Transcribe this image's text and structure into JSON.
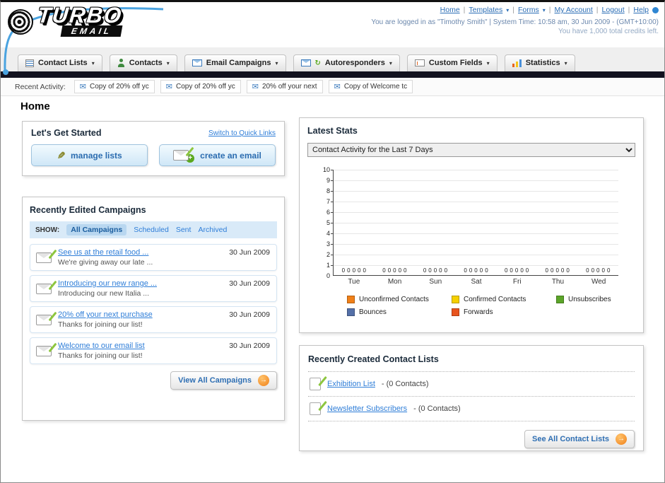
{
  "header": {
    "logo_text": "TURBO",
    "logo_sub": "EMAIL",
    "nav_links": [
      "Home",
      "Templates",
      "Forms",
      "My Account",
      "Logout",
      "Help"
    ],
    "login_info": "You are logged in as \"Timothy Smith\" | System Time: 10:58 am, 30 Jun 2009 - (GMT+10:00)",
    "credits_info": "You have 1,000 total credits left."
  },
  "nav_tabs": [
    {
      "label": "Contact Lists"
    },
    {
      "label": "Contacts"
    },
    {
      "label": "Email Campaigns"
    },
    {
      "label": "Autoresponders"
    },
    {
      "label": "Custom Fields"
    },
    {
      "label": "Statistics"
    }
  ],
  "recent_activity": {
    "label": "Recent Activity:",
    "items": [
      "Copy of 20% off yc",
      "Copy of 20% off yc",
      "20% off your next",
      "Copy of Welcome tc"
    ]
  },
  "page_title": "Home",
  "get_started": {
    "title": "Let's Get Started",
    "switch_link": "Switch to Quick Links",
    "buttons": [
      {
        "label": "manage lists"
      },
      {
        "label": "create an email"
      }
    ]
  },
  "campaigns": {
    "title": "Recently Edited Campaigns",
    "show_label": "SHOW:",
    "filters": [
      "All Campaigns",
      "Scheduled",
      "Sent",
      "Archived"
    ],
    "active_filter": "All Campaigns",
    "items": [
      {
        "title": "See us at the retail food ...",
        "subtitle": "We're giving away our late ...",
        "date": "30 Jun 2009"
      },
      {
        "title": "Introducing our new range ...",
        "subtitle": "Introducing our new Italia ...",
        "date": "30 Jun 2009"
      },
      {
        "title": "20% off your next purchase",
        "subtitle": "Thanks for joining our list!",
        "date": "30 Jun 2009"
      },
      {
        "title": "Welcome to our email list",
        "subtitle": "Thanks for joining our list!",
        "date": "30 Jun 2009"
      }
    ],
    "view_all_label": "View All Campaigns"
  },
  "stats": {
    "title": "Latest Stats",
    "dropdown_value": "Contact Activity for the Last 7 Days",
    "chart_data": {
      "type": "bar",
      "categories": [
        "Tue",
        "Mon",
        "Sun",
        "Sat",
        "Fri",
        "Thu",
        "Wed"
      ],
      "series": [
        {
          "name": "Unconfirmed Contacts",
          "color": "#f08019",
          "values": [
            0,
            0,
            0,
            0,
            0,
            0,
            0
          ]
        },
        {
          "name": "Confirmed Contacts",
          "color": "#f5d000",
          "values": [
            0,
            0,
            0,
            0,
            0,
            0,
            0
          ]
        },
        {
          "name": "Unsubscribes",
          "color": "#5ba529",
          "values": [
            0,
            0,
            0,
            0,
            0,
            0,
            0
          ]
        },
        {
          "name": "Bounces",
          "color": "#5470a8",
          "values": [
            0,
            0,
            0,
            0,
            0,
            0,
            0
          ]
        },
        {
          "name": "Forwards",
          "color": "#e8541e",
          "values": [
            0,
            0,
            0,
            0,
            0,
            0,
            0
          ]
        }
      ],
      "ylim": [
        0,
        10
      ],
      "yticks": [
        0,
        1,
        2,
        3,
        4,
        5,
        6,
        7,
        8,
        9,
        10
      ],
      "grid": true,
      "legend_position": "bottom"
    },
    "legend": [
      {
        "label": "Unconfirmed Contacts",
        "color": "#f08019"
      },
      {
        "label": "Confirmed Contacts",
        "color": "#f5d000"
      },
      {
        "label": "Unsubscribes",
        "color": "#5ba529"
      },
      {
        "label": "Bounces",
        "color": "#5470a8"
      },
      {
        "label": "Forwards",
        "color": "#e8541e"
      }
    ]
  },
  "contact_lists": {
    "title": "Recently Created Contact Lists",
    "items": [
      {
        "name": "Exhibition List",
        "detail": "- (0 Contacts)"
      },
      {
        "name": "Newsletter Subscribers",
        "detail": "- (0 Contacts)"
      }
    ],
    "see_all_label": "See All Contact Lists"
  }
}
